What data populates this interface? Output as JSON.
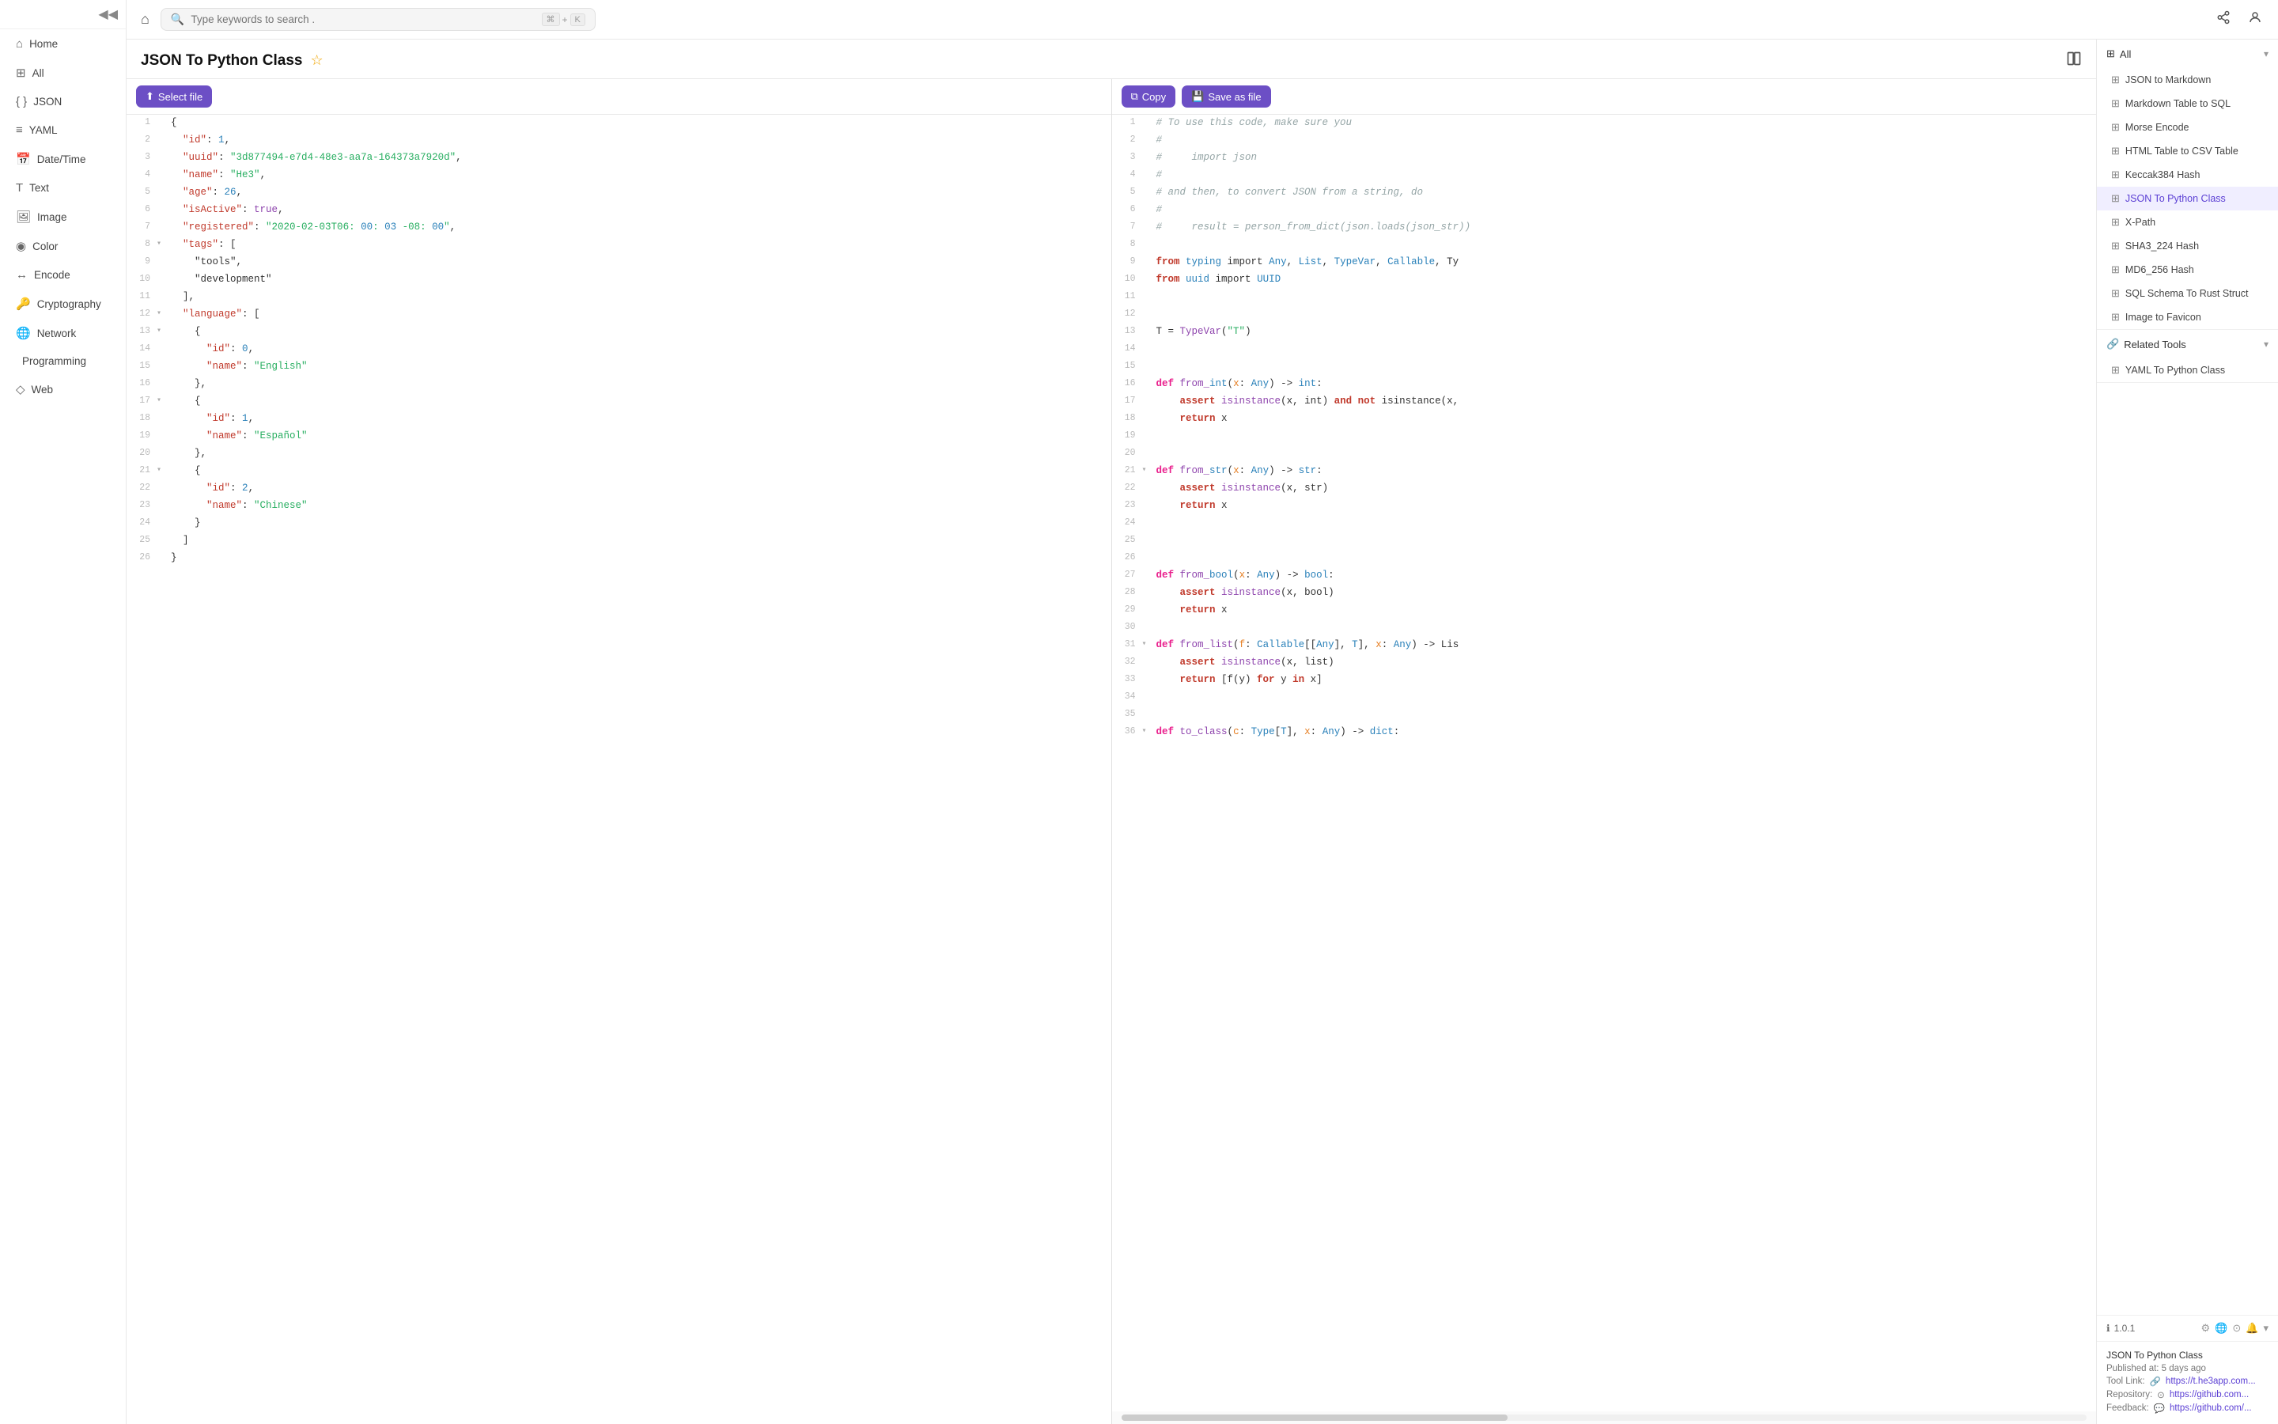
{
  "sidebar": {
    "collapse_icon": "◀◀",
    "items": [
      {
        "id": "home",
        "label": "Home",
        "icon": "⌂",
        "active": false
      },
      {
        "id": "all",
        "label": "All",
        "icon": "⊞",
        "active": false
      },
      {
        "id": "json",
        "label": "JSON",
        "icon": "{ }",
        "active": false
      },
      {
        "id": "yaml",
        "label": "YAML",
        "icon": "≡",
        "active": false
      },
      {
        "id": "datetime",
        "label": "Date/Time",
        "icon": "📅",
        "active": false
      },
      {
        "id": "text",
        "label": "Text",
        "icon": "T",
        "active": false
      },
      {
        "id": "image",
        "label": "Image",
        "icon": "🖼",
        "active": false
      },
      {
        "id": "color",
        "label": "Color",
        "icon": "◉",
        "active": false
      },
      {
        "id": "encode",
        "label": "Encode",
        "icon": "↔",
        "active": false
      },
      {
        "id": "cryptography",
        "label": "Cryptography",
        "icon": "🔑",
        "active": false
      },
      {
        "id": "network",
        "label": "Network",
        "icon": "🌐",
        "active": false
      },
      {
        "id": "programming",
        "label": "Programming",
        "icon": "</>",
        "active": false
      },
      {
        "id": "web",
        "label": "Web",
        "icon": "◇",
        "active": false
      }
    ]
  },
  "topbar": {
    "home_icon": "⌂",
    "search_placeholder": "Type keywords to search .",
    "search_shortcut_cmd": "⌘",
    "search_shortcut_plus": "+",
    "search_shortcut_k": "K",
    "share_icon": "share",
    "user_icon": "user"
  },
  "tool": {
    "title": "JSON To Python Class",
    "star_icon": "☆",
    "layout_icon": "⊟",
    "left_toolbar": {
      "select_file_label": "Select file",
      "select_file_icon": "⬆"
    },
    "right_toolbar": {
      "copy_label": "Copy",
      "copy_icon": "⧉",
      "save_label": "Save as file",
      "save_icon": "💾"
    },
    "left_code": [
      {
        "num": 1,
        "expand": "",
        "code": "{"
      },
      {
        "num": 2,
        "expand": "",
        "code": "  \"id\": 1,"
      },
      {
        "num": 3,
        "expand": "",
        "code": "  \"uuid\": \"3d877494-e7d4-48e3-aa7a-164373a7920d\","
      },
      {
        "num": 4,
        "expand": "",
        "code": "  \"name\": \"He3\","
      },
      {
        "num": 5,
        "expand": "",
        "code": "  \"age\": 26,"
      },
      {
        "num": 6,
        "expand": "",
        "code": "  \"isActive\": true,"
      },
      {
        "num": 7,
        "expand": "",
        "code": "  \"registered\": \"2020-02-03T06:00:03 -08:00\","
      },
      {
        "num": 8,
        "expand": "▾",
        "code": "  \"tags\": ["
      },
      {
        "num": 9,
        "expand": "",
        "code": "    \"tools\","
      },
      {
        "num": 10,
        "expand": "",
        "code": "    \"development\""
      },
      {
        "num": 11,
        "expand": "",
        "code": "  ],"
      },
      {
        "num": 12,
        "expand": "▾",
        "code": "  \"language\": ["
      },
      {
        "num": 13,
        "expand": "▾",
        "code": "    {"
      },
      {
        "num": 14,
        "expand": "",
        "code": "      \"id\": 0,"
      },
      {
        "num": 15,
        "expand": "",
        "code": "      \"name\": \"English\""
      },
      {
        "num": 16,
        "expand": "",
        "code": "    },"
      },
      {
        "num": 17,
        "expand": "▾",
        "code": "    {"
      },
      {
        "num": 18,
        "expand": "",
        "code": "      \"id\": 1,"
      },
      {
        "num": 19,
        "expand": "",
        "code": "      \"name\": \"Español\""
      },
      {
        "num": 20,
        "expand": "",
        "code": "    },"
      },
      {
        "num": 21,
        "expand": "▾",
        "code": "    {"
      },
      {
        "num": 22,
        "expand": "",
        "code": "      \"id\": 2,"
      },
      {
        "num": 23,
        "expand": "",
        "code": "      \"name\": \"Chinese\""
      },
      {
        "num": 24,
        "expand": "",
        "code": "    }"
      },
      {
        "num": 25,
        "expand": "",
        "code": "  ]"
      },
      {
        "num": 26,
        "expand": "",
        "code": "}"
      }
    ],
    "right_code_lines": [
      {
        "num": 1,
        "expand": "",
        "type": "comment",
        "code": "# To use this code, make sure you"
      },
      {
        "num": 2,
        "expand": "",
        "type": "comment",
        "code": "#"
      },
      {
        "num": 3,
        "expand": "",
        "type": "comment",
        "code": "#     import json"
      },
      {
        "num": 4,
        "expand": "",
        "type": "comment",
        "code": "#"
      },
      {
        "num": 5,
        "expand": "",
        "type": "comment",
        "code": "# and then, to convert JSON from a string, do"
      },
      {
        "num": 6,
        "expand": "",
        "type": "comment",
        "code": "#"
      },
      {
        "num": 7,
        "expand": "",
        "type": "comment",
        "code": "#     result = person_from_dict(json.loads(json_str))"
      },
      {
        "num": 8,
        "expand": "",
        "type": "blank",
        "code": ""
      },
      {
        "num": 9,
        "expand": "",
        "type": "import",
        "code": "from typing import Any, List, TypeVar, Callable, Ty"
      },
      {
        "num": 10,
        "expand": "",
        "type": "import",
        "code": "from uuid import UUID"
      },
      {
        "num": 11,
        "expand": "",
        "type": "blank",
        "code": ""
      },
      {
        "num": 12,
        "expand": "",
        "type": "blank",
        "code": ""
      },
      {
        "num": 13,
        "expand": "",
        "type": "code",
        "code": "T = TypeVar(\"T\")"
      },
      {
        "num": 14,
        "expand": "",
        "type": "blank",
        "code": ""
      },
      {
        "num": 15,
        "expand": "",
        "type": "blank",
        "code": ""
      },
      {
        "num": 16,
        "expand": "",
        "type": "def",
        "code": "def from_int(x: Any) -> int:"
      },
      {
        "num": 17,
        "expand": "",
        "type": "code",
        "code": "    assert isinstance(x, int) and not isinstance(x,"
      },
      {
        "num": 18,
        "expand": "",
        "type": "code",
        "code": "    return x"
      },
      {
        "num": 19,
        "expand": "",
        "type": "blank",
        "code": ""
      },
      {
        "num": 20,
        "expand": "",
        "type": "blank",
        "code": ""
      },
      {
        "num": 21,
        "expand": "▾",
        "type": "def",
        "code": "def from_str(x: Any) -> str:"
      },
      {
        "num": 22,
        "expand": "",
        "type": "code",
        "code": "    assert isinstance(x, str)"
      },
      {
        "num": 23,
        "expand": "",
        "type": "code",
        "code": "    return x"
      },
      {
        "num": 24,
        "expand": "",
        "type": "blank",
        "code": ""
      },
      {
        "num": 25,
        "expand": "",
        "type": "blank",
        "code": ""
      },
      {
        "num": 26,
        "expand": "",
        "type": "blank",
        "code": ""
      },
      {
        "num": 27,
        "expand": "",
        "type": "def",
        "code": "def from_bool(x: Any) -> bool:"
      },
      {
        "num": 28,
        "expand": "",
        "type": "code",
        "code": "    assert isinstance(x, bool)"
      },
      {
        "num": 29,
        "expand": "",
        "type": "code",
        "code": "    return x"
      },
      {
        "num": 30,
        "expand": "",
        "type": "blank",
        "code": ""
      },
      {
        "num": 31,
        "expand": "▾",
        "type": "def",
        "code": "def from_list(f: Callable[[Any], T], x: Any) -> Lis"
      },
      {
        "num": 32,
        "expand": "",
        "type": "code",
        "code": "    assert isinstance(x, list)"
      },
      {
        "num": 33,
        "expand": "",
        "type": "code",
        "code": "    return [f(y) for y in x]"
      },
      {
        "num": 34,
        "expand": "",
        "type": "blank",
        "code": ""
      },
      {
        "num": 35,
        "expand": "",
        "type": "blank",
        "code": ""
      },
      {
        "num": 36,
        "expand": "▾",
        "type": "def",
        "code": "def to_class(c: Type[T], x: Any) -> dict:"
      }
    ]
  },
  "right_sidebar": {
    "all_section": {
      "header": "All",
      "header_icon": "⊞",
      "items": [
        {
          "label": "JSON to Markdown",
          "icon": "⊞",
          "active": false
        },
        {
          "label": "Markdown Table to SQL",
          "icon": "⊞",
          "active": false
        },
        {
          "label": "Morse Encode",
          "icon": "⊞",
          "active": false
        },
        {
          "label": "HTML Table to CSV Table",
          "icon": "⊞",
          "active": false
        },
        {
          "label": "Keccak384 Hash",
          "icon": "⊞",
          "active": false
        },
        {
          "label": "JSON To Python Class",
          "icon": "⊞",
          "active": true
        },
        {
          "label": "X-Path",
          "icon": "⊞",
          "active": false
        },
        {
          "label": "SHA3_224 Hash",
          "icon": "⊞",
          "active": false
        },
        {
          "label": "MD6_256 Hash",
          "icon": "⊞",
          "active": false
        },
        {
          "label": "SQL Schema To Rust Struct",
          "icon": "⊞",
          "active": false
        },
        {
          "label": "Image to Favicon",
          "icon": "⊞",
          "active": false
        }
      ]
    },
    "related_section": {
      "header": "Related Tools",
      "header_icon": "🔗",
      "items": [
        {
          "label": "YAML To Python Class",
          "icon": "⊞",
          "active": false
        }
      ]
    },
    "version": {
      "label": "1.0.1",
      "icon": "ℹ"
    },
    "bottom_info": {
      "title": "JSON To Python Class",
      "published": "Published at: 5 days ago",
      "tool_link_label": "Tool Link:",
      "tool_link_url": "https://t.he3app.com...",
      "repo_label": "Repository:",
      "repo_url": "https://github.com...",
      "feedback_label": "Feedback:",
      "feedback_url": "https://github.com/..."
    }
  }
}
